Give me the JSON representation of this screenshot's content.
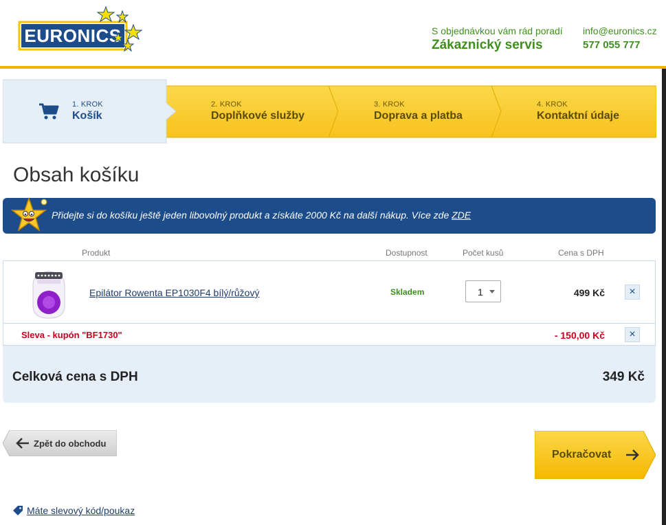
{
  "header": {
    "logo_text": "EURONICS",
    "contact_tagline": "S objednávkou vám rád poradí",
    "contact_title": "Zákaznický servis",
    "email": "info@euronics.cz",
    "phone": "577 055 777"
  },
  "steps": [
    {
      "num": "1. KROK",
      "label": "Košík",
      "active": true
    },
    {
      "num": "2. KROK",
      "label": "Doplňkové služby",
      "active": false
    },
    {
      "num": "3. KROK",
      "label": "Doprava a platba",
      "active": false
    },
    {
      "num": "4. KROK",
      "label": "Kontaktní údaje",
      "active": false
    }
  ],
  "page_title": "Obsah košíku",
  "promo": {
    "text": "Přidejte si do košíku ještě jeden libovolný produkt a získáte 2000 Kč na další nákup. Více zde ",
    "link_text": "ZDE"
  },
  "table": {
    "headers": {
      "product": "Produkt",
      "availability": "Dostupnost",
      "quantity": "Počet kusů",
      "price": "Cena s DPH"
    },
    "items": [
      {
        "name": "Epilátor Rowenta EP1030F4 bílý/růžový",
        "availability": "Skladem",
        "quantity": "1",
        "price": "499 Kč"
      }
    ],
    "discount": {
      "label": "Sleva - kupón \"BF1730\"",
      "price": "- 150,00 Kč"
    },
    "remove_symbol": "×"
  },
  "total": {
    "label": "Celková cena s DPH",
    "price": "349 Kč"
  },
  "buttons": {
    "back": "Zpět do obchodu",
    "continue": "Pokračovat"
  },
  "coupon_link": "Máte slevový kód/poukaz",
  "colors": {
    "brand_blue": "#1d4c8a",
    "brand_yellow": "#f9c829",
    "green": "#3e8f1c",
    "red": "#c8001e"
  },
  "icons": [
    "cart-icon",
    "star-mascot-icon",
    "remove-icon",
    "arrow-left-icon",
    "arrow-right-icon",
    "tag-icon",
    "chevron-down-icon"
  ]
}
